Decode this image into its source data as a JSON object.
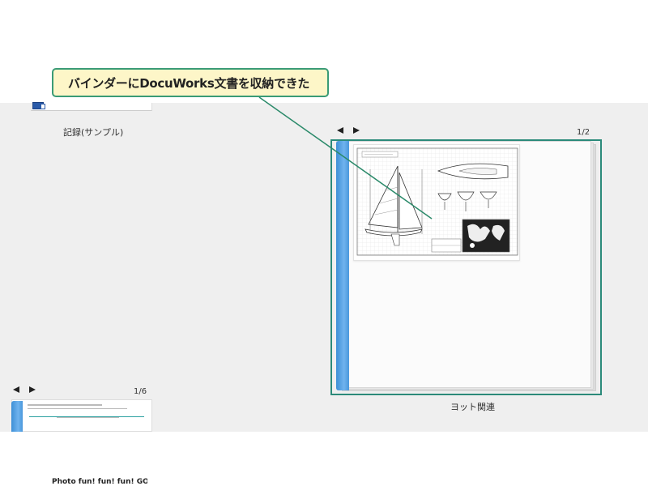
{
  "callout": {
    "text": "バインダーにDocuWorks文書を収納できた"
  },
  "binders": {
    "top_left": {
      "label": "記録(サンプル)"
    },
    "main": {
      "label": "ヨット関連",
      "page_count": "1/2"
    },
    "bottom_left": {
      "page_count": "1/6",
      "preview_title": "Photo fun! fun! fun! GO!"
    }
  },
  "colors": {
    "callout_bg": "#fdf6c8",
    "callout_border": "#3a9b76",
    "selection_border": "#2b8a7a",
    "spine": "#4a98dc",
    "workspace": "#efefef"
  },
  "icons": {
    "nav_left": "triangle-left",
    "nav_right": "triangle-right",
    "docuworks": "docuworks-file-icon"
  }
}
